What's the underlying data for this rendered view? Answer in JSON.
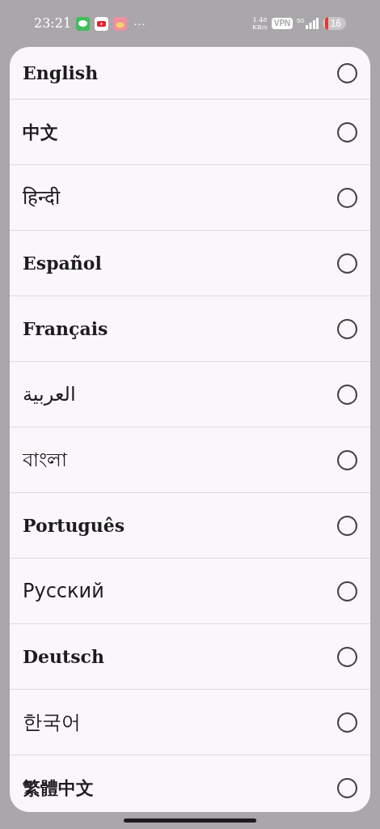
{
  "status_bar": {
    "time": "23:21",
    "more": "···",
    "speed_value": "1.48",
    "speed_unit": "KB/s",
    "vpn": "VPN",
    "network": "5G",
    "battery": "16"
  },
  "languages": [
    {
      "label": "English",
      "kind": "serif",
      "selected": false
    },
    {
      "label": "中文",
      "kind": "serif",
      "selected": false
    },
    {
      "label": "हिन्दी",
      "kind": "sans",
      "selected": false
    },
    {
      "label": "Español",
      "kind": "serif",
      "selected": false
    },
    {
      "label": "Français",
      "kind": "serif",
      "selected": false
    },
    {
      "label": "العربية",
      "kind": "sans",
      "selected": false
    },
    {
      "label": "বাংলা",
      "kind": "sans",
      "selected": false
    },
    {
      "label": "Português",
      "kind": "serif",
      "selected": false
    },
    {
      "label": "Русский",
      "kind": "sans",
      "selected": false
    },
    {
      "label": "Deutsch",
      "kind": "serif",
      "selected": false
    },
    {
      "label": "한국어",
      "kind": "sans",
      "selected": false
    },
    {
      "label": "繁體中文",
      "kind": "serif",
      "selected": false
    }
  ]
}
